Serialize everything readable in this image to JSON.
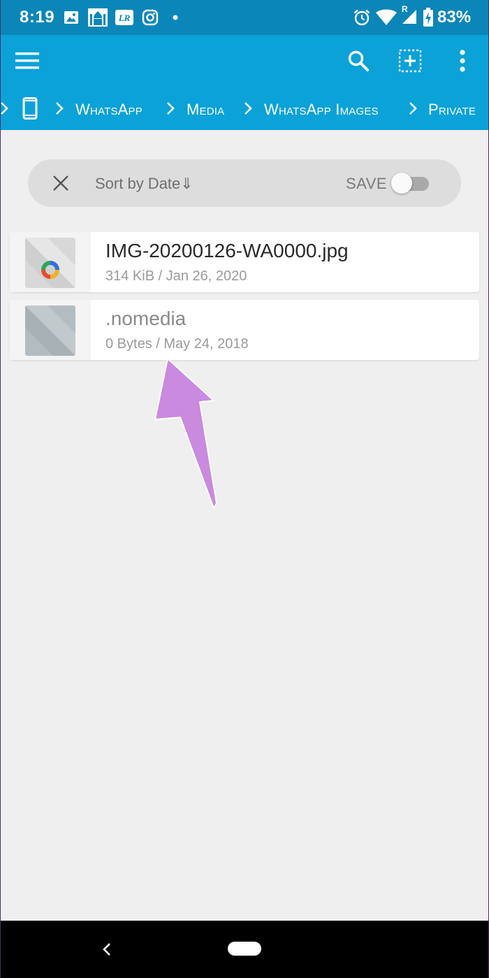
{
  "status_bar": {
    "time": "8:19",
    "battery": "83%",
    "notification_icons": [
      "gallery-icon",
      "mosque-icon",
      "lightroom-icon",
      "instagram-icon",
      "dot-icon"
    ],
    "system_icons": [
      "alarm-icon",
      "wifi-icon",
      "signal-icon",
      "battery-charging-icon"
    ],
    "signal_badge": "R"
  },
  "app_bar": {
    "actions": [
      "menu-icon",
      "search-icon",
      "select-add-icon",
      "more-vert-icon"
    ],
    "breadcrumb": [
      "WhatsApp",
      "Media",
      "WhatsApp Images",
      "Private"
    ],
    "color": "#0ba2d8"
  },
  "sort_bar": {
    "label": "Sort by Date⇓",
    "save_label": "SAVE",
    "save_toggle_on": false
  },
  "files": [
    {
      "name": "IMG-20200126-WA0000.jpg",
      "meta": "314 KiB / Jan 26, 2020"
    },
    {
      "name": ".nomedia",
      "meta": "0 Bytes / May 24, 2018"
    }
  ],
  "nav_bar": {
    "buttons": [
      "back-icon",
      "home-pill"
    ]
  },
  "annotation": {
    "arrow_color": "#c98ae0"
  }
}
